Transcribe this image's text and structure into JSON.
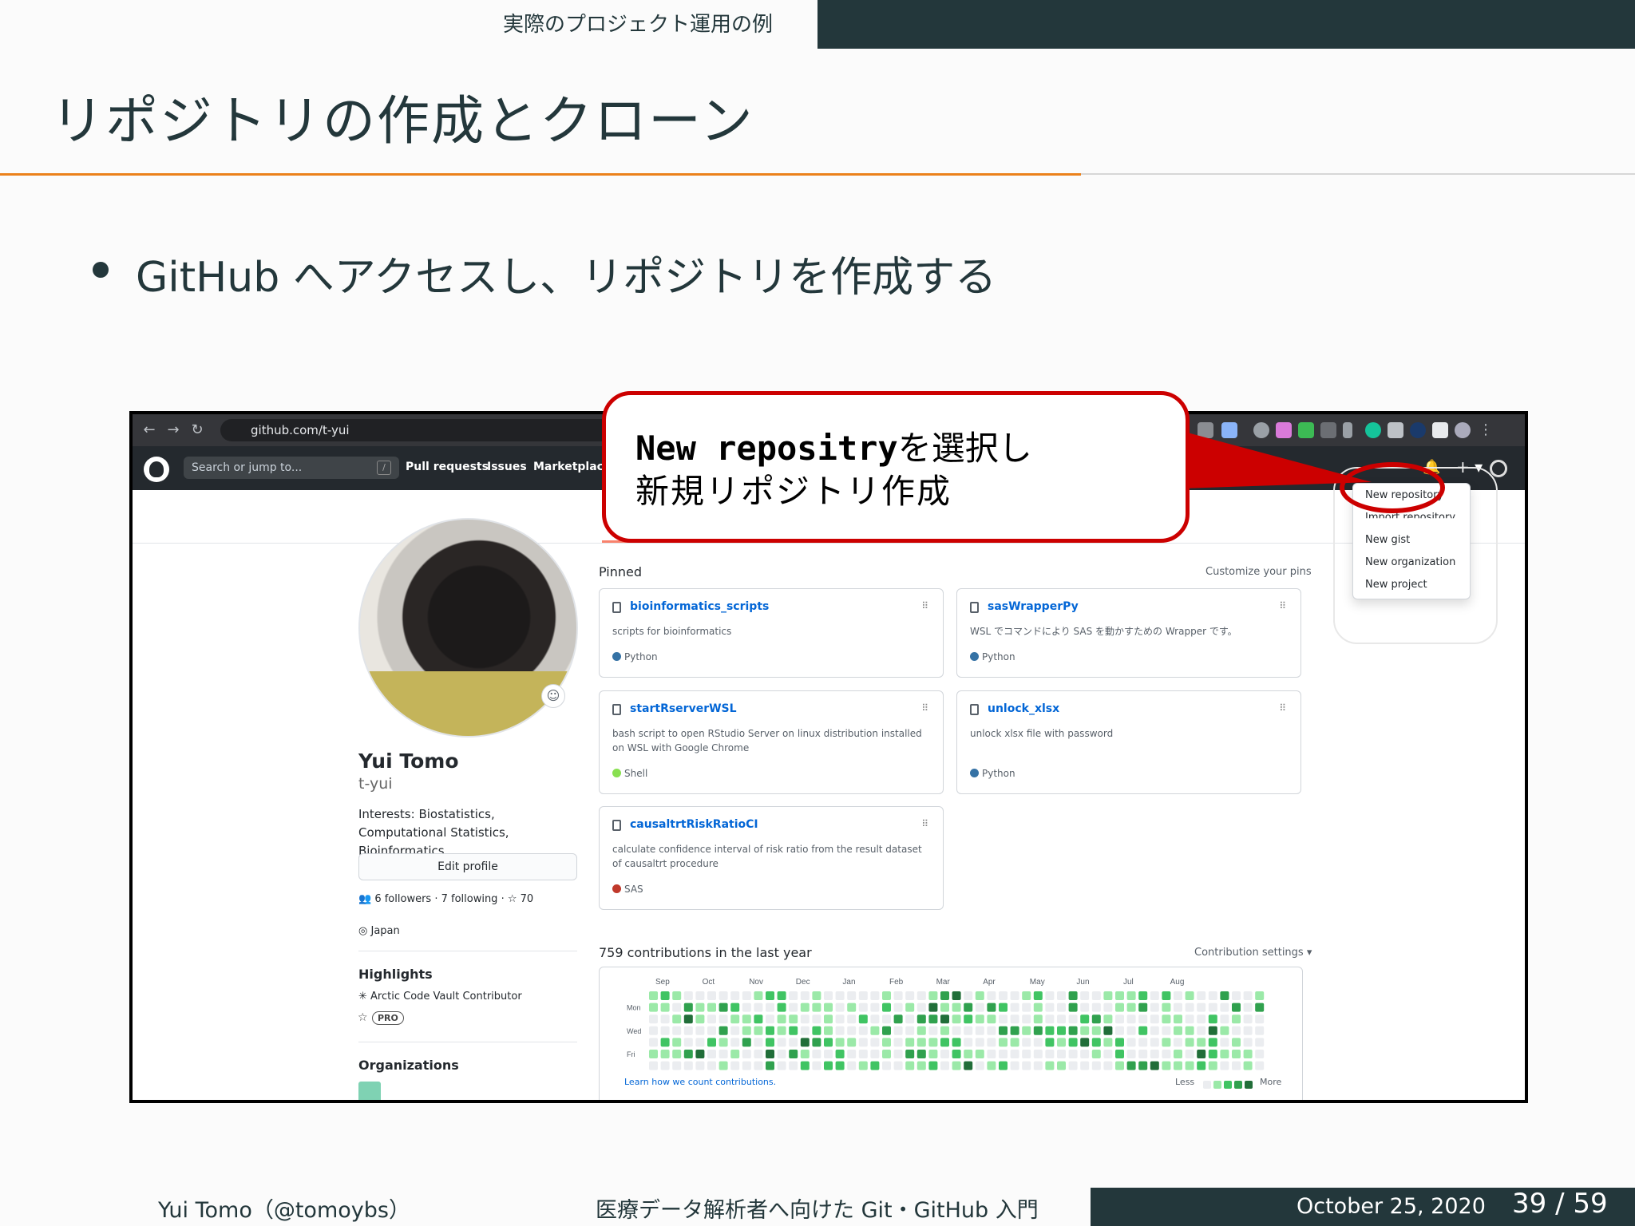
{
  "slide": {
    "section": "実際のプロジェクト運用の例",
    "title": "リポジトリの作成とクローン",
    "bullet": "GitHub へアクセスし、リポジトリを作成する"
  },
  "callout": {
    "code": "New repositry",
    "line1_rest": "を選択し",
    "line2": "新規リポジトリ作成"
  },
  "browser": {
    "url": "github.com/t-yui",
    "back_icon": "←",
    "forward_icon": "→",
    "reload_icon": "↻"
  },
  "github": {
    "search_placeholder": "Search or jump to...",
    "slash_key": "/",
    "nav": [
      "Pull requests",
      "Issues",
      "Marketplace"
    ],
    "bell_icon": "🔔",
    "plus_icon": "+ ▾"
  },
  "dropdown": {
    "items": [
      "New repository",
      "Import repository",
      "New gist",
      "New organization",
      "New project"
    ]
  },
  "profile": {
    "name": "Yui Tomo",
    "login": "t-yui",
    "bio": "Interests: Biostatistics, Computational Statistics, Bioinformatics",
    "edit_button": "Edit profile",
    "follow_line": "6 followers · 7 following · ☆ 70",
    "location": "Japan",
    "highlights_heading": "Highlights",
    "highlight_item": "Arctic Code Vault Contributor",
    "pro_badge": "PRO",
    "organizations_heading": "Organizations"
  },
  "pinned": {
    "label": "Pinned",
    "customize": "Customize your pins",
    "repos": [
      {
        "name": "bioinformatics_scripts",
        "desc": "scripts for bioinformatics",
        "lang": "Python",
        "color": "#3572A5"
      },
      {
        "name": "sasWrapperPy",
        "desc": "WSL でコマンドにより SAS を動かすための Wrapper です。",
        "lang": "Python",
        "color": "#3572A5"
      },
      {
        "name": "startRserverWSL",
        "desc": "bash script to open RStudio Server on linux distribution installed on WSL with Google Chrome",
        "lang": "Shell",
        "color": "#89e051"
      },
      {
        "name": "unlock_xlsx",
        "desc": "unlock xlsx file with password",
        "lang": "Python",
        "color": "#3572A5"
      },
      {
        "name": "causaltrtRiskRatioCI",
        "desc": "calculate confidence interval of risk ratio from the result dataset of causaltrt procedure",
        "lang": "SAS",
        "color": "#c0392b"
      }
    ]
  },
  "contributions": {
    "title": "759 contributions in the last year",
    "settings": "Contribution settings ▾",
    "months": [
      "Sep",
      "Oct",
      "Nov",
      "Dec",
      "Jan",
      "Feb",
      "Mar",
      "Apr",
      "May",
      "Jun",
      "Jul",
      "Aug"
    ],
    "days": [
      "Mon",
      "Wed",
      "Fri"
    ],
    "learn": "Learn how we count contributions.",
    "less": "Less",
    "more": "More",
    "palette": [
      "#ebedf0",
      "#9be9a8",
      "#40c463",
      "#30a14e",
      "#216e39"
    ]
  },
  "footer": {
    "author": "Yui Tomo（@tomoybs）",
    "title": "医療データ解析者へ向けた Git・GitHub 入門",
    "date": "October 25, 2020",
    "page": "39 / 59"
  },
  "colors": {
    "accent": "#eb811b",
    "dark": "#23373b",
    "callout_red": "#cc0000"
  }
}
